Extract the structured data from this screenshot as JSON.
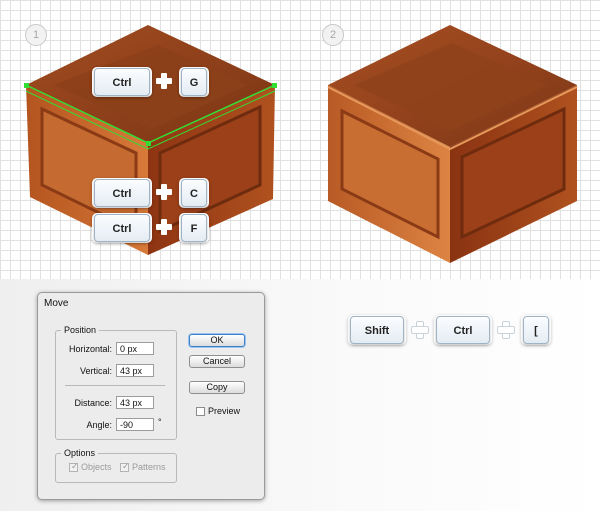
{
  "steps": {
    "step1": "1",
    "step2": "2"
  },
  "crate1_shortcuts": {
    "row1": {
      "modifier": "Ctrl",
      "key": "G"
    },
    "row2": {
      "modifier": "Ctrl",
      "key": "C"
    },
    "row3": {
      "modifier": "Ctrl",
      "key": "F"
    }
  },
  "bottom_shortcut": {
    "key1": "Shift",
    "key2": "Ctrl",
    "key3": "["
  },
  "move_dialog": {
    "title": "Move",
    "position_legend": "Position",
    "horizontal_label": "Horizontal:",
    "horizontal_value": "0 px",
    "vertical_label": "Vertical:",
    "vertical_value": "43 px",
    "distance_label": "Distance:",
    "distance_value": "43 px",
    "angle_label": "Angle:",
    "angle_value": "-90",
    "angle_unit": "°",
    "options_legend": "Options",
    "objects_label": "Objects",
    "patterns_label": "Patterns",
    "ok_label": "OK",
    "cancel_label": "Cancel",
    "copy_label": "Copy",
    "preview_label": "Preview"
  },
  "colors": {
    "crate_top": "#8a3e1a",
    "crate_left": "#c2642c",
    "crate_right": "#9e4018",
    "selection_highlight": "#33dd33",
    "key_border": "#9fb3c4"
  }
}
